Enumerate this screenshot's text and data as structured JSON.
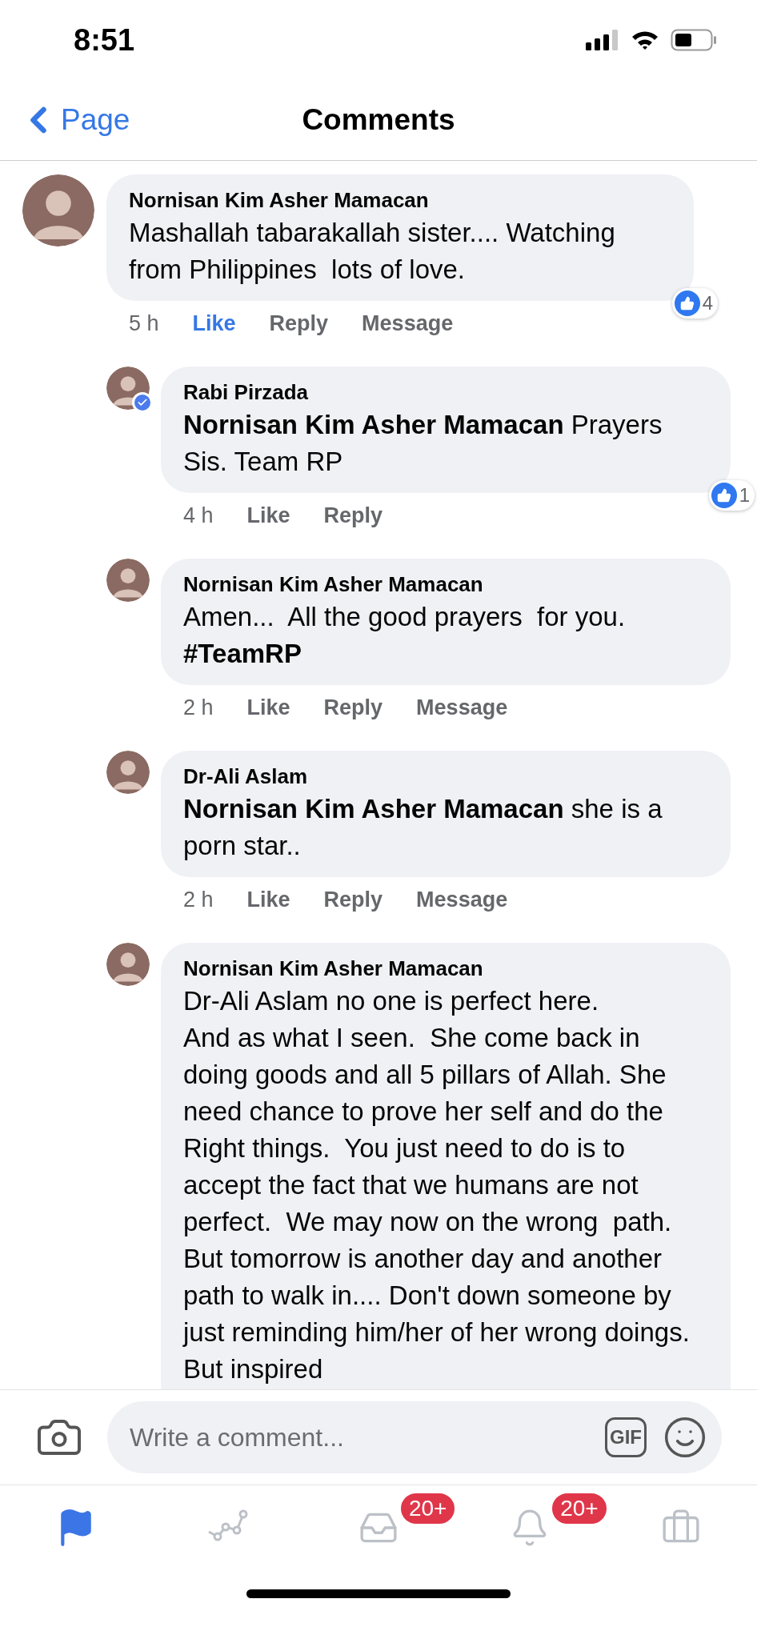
{
  "status_bar": {
    "time": "8:51"
  },
  "header": {
    "back_label": "Page",
    "title": "Comments"
  },
  "comments": [
    {
      "author": "Nornisan Kim Asher Mamacan",
      "verified": false,
      "text": "Mashallah tabarakallah sister.... Watching from Philippines  lots of love.",
      "time": "5 h",
      "actions": [
        {
          "label": "Like",
          "selected": true
        },
        {
          "label": "Reply",
          "selected": false
        },
        {
          "label": "Message",
          "selected": false
        }
      ],
      "reactions": "4",
      "replies": [
        {
          "author": "Rabi Pirzada",
          "verified": true,
          "text": "**Nornisan Kim Asher Mamacan** Prayers Sis. Team RP",
          "time": "4 h",
          "actions": [
            {
              "label": "Like",
              "selected": false
            },
            {
              "label": "Reply",
              "selected": false
            }
          ],
          "reactions": "1"
        },
        {
          "author": "Nornisan Kim Asher Mamacan",
          "verified": false,
          "text": "Amen...  All the good prayers  for you. **#TeamRP**",
          "time": "2 h",
          "actions": [
            {
              "label": "Like",
              "selected": false
            },
            {
              "label": "Reply",
              "selected": false
            },
            {
              "label": "Message",
              "selected": false
            }
          ]
        },
        {
          "author": "Dr-Ali Aslam",
          "verified": false,
          "text": "**Nornisan Kim Asher Mamacan** she is a porn star..",
          "time": "2 h",
          "actions": [
            {
              "label": "Like",
              "selected": false
            },
            {
              "label": "Reply",
              "selected": false
            },
            {
              "label": "Message",
              "selected": false
            }
          ]
        },
        {
          "author": "Nornisan Kim Asher Mamacan",
          "verified": false,
          "text": "Dr-Ali Aslam no one is perfect here.\nAnd as what I seen.  She come back in doing goods and all 5 pillars of Allah. She need chance to prove her self and do the Right things.  You just need to do is to accept the fact that we humans are not perfect.  We may now on the wrong  path.  But tomorrow is another day and another path to walk in.... Don't down someone by just reminding him/her of her wrong doings.  But inspired"
        }
      ]
    }
  ],
  "composer": {
    "placeholder": "Write a comment...",
    "gif_label": "GIF"
  },
  "tab_bar": [
    {
      "selected": true
    },
    {
      "selected": false
    },
    {
      "selected": false,
      "badge": "20+"
    },
    {
      "selected": false,
      "badge": "20+"
    },
    {
      "selected": false
    }
  ]
}
